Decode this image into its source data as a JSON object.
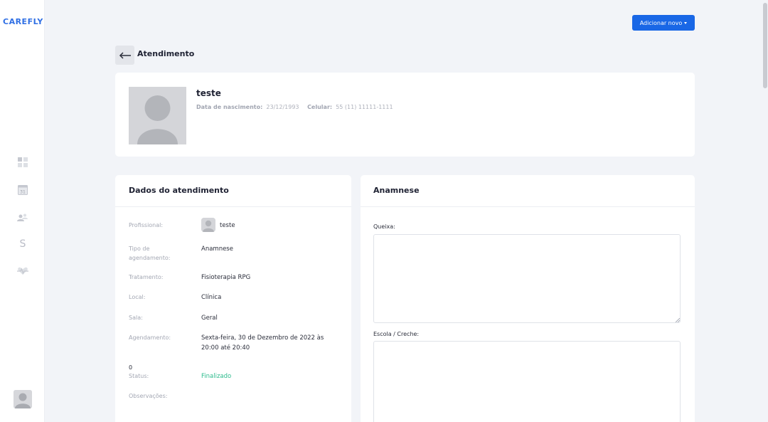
{
  "app": {
    "logo": "CAREFLY"
  },
  "sidebar": {
    "items": [
      {
        "icon": "dashboard-icon"
      },
      {
        "icon": "calendar-icon",
        "text": "31"
      },
      {
        "icon": "patients-icon"
      },
      {
        "icon": "finance-icon",
        "text": "S"
      },
      {
        "icon": "health-icon"
      }
    ],
    "avatar_icon": "user-avatar-icon"
  },
  "header": {
    "add_new_label": "Adicionar novo"
  },
  "page": {
    "title": "Atendimento",
    "back_icon": "arrow-left-icon"
  },
  "patient": {
    "name": "teste",
    "birth_label": "Data de nascimento:",
    "birth_value": "23/12/1993",
    "phone_label": "Celular:",
    "phone_value": "55 (11) 11111-1111"
  },
  "details": {
    "title": "Dados do atendimento",
    "profissional_label": "Profissional:",
    "profissional_value": "teste",
    "tipo_label_1": "Tipo de",
    "tipo_label_2": "agendamento:",
    "tipo_value": "Anamnese",
    "tratamento_label": "Tratamento:",
    "tratamento_value": "Fisioterapia RPG",
    "local_label": "Local:",
    "local_value": "Clínica",
    "sala_label": "Sala:",
    "sala_value": "Geral",
    "agendamento_label": "Agendamento:",
    "agendamento_line1": "Sexta-feira, 30 de Dezembro de 2022 às",
    "agendamento_line2": "20:00 até 20:40",
    "counter": "0",
    "status_label": "Status:",
    "status_value": "Finalizado",
    "observacoes_label": "Observações:"
  },
  "anamnese": {
    "title": "Anamnese",
    "queixa_label": "Queixa:",
    "queixa_value": "",
    "escola_label": "Escola / Creche:",
    "escola_value": ""
  },
  "colors": {
    "accent": "#1967e6",
    "logo": "#2f6fe4",
    "status": "#2dbb8d",
    "background": "#f2f4f8"
  }
}
